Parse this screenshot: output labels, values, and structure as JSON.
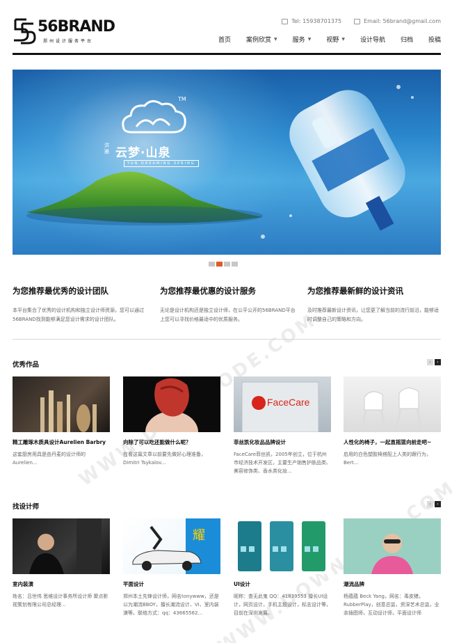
{
  "header": {
    "logo_text": "56BRAND",
    "logo_tagline": "郑州设计服务平台",
    "tel": "Tel: 15938701375",
    "email": "Email: 56brand@gmail.com",
    "nav": [
      {
        "label": "首页",
        "has_dropdown": false
      },
      {
        "label": "案例欣赏",
        "has_dropdown": true
      },
      {
        "label": "服务",
        "has_dropdown": true
      },
      {
        "label": "视野",
        "has_dropdown": true
      },
      {
        "label": "设计导航",
        "has_dropdown": false
      },
      {
        "label": "归档",
        "has_dropdown": false
      },
      {
        "label": "投稿",
        "has_dropdown": false
      }
    ]
  },
  "banner": {
    "brand_cn": "云梦·山泉",
    "brand_side": "洪雅",
    "brand_en": "YUN DREAMING SPRING",
    "tm": "TM",
    "slides": 4,
    "active_slide": 2
  },
  "intro": [
    {
      "title": "为您推荐最优秀的设计团队",
      "text": "本平台集合了优秀的设计机构和独立设计师资源，您可以通过56BRAND找到能够满足您设计需求的设计团队。"
    },
    {
      "title": "为您推荐最优惠的设计服务",
      "text": "无论是设计机构还是独立设计师，在公平公开的56BRAND平台上您可以寻找价格最适中的优质服务。"
    },
    {
      "title": "为您推荐最新鲜的设计资讯",
      "text": "及时推荐最新设计资讯，让您更了解当前的流行前沿，能够适时调整自己的策略和方向。"
    }
  ],
  "works": {
    "title": "优秀作品",
    "items": [
      {
        "title": "精工雕琢木质具设计Aurelien Barbry",
        "text": "这套厨房用具是由丹麦的设计师的Aurelien..."
      },
      {
        "title": "向除了可以吃还能做什么呢？",
        "text": "在看这篇文章以前要先做好心理准备，Dimitri Tsykalov..."
      },
      {
        "title": "菲丝凯化妆品品牌设计",
        "text": "FaceCare菲丝凯，2005年创立，位于杭州市经济技术开发区，主要生产销售护肤品类、美容修饰类、香水类化妆..."
      },
      {
        "title": "人性化的椅子，一起直摇篮向前走吧~",
        "text": "启用的白色塑胶椅搭配上人类的跟行为，Bert..."
      }
    ]
  },
  "designers": {
    "title": "找设计师",
    "items": [
      {
        "title": "室内装潢",
        "text": "姓名：吕世伟 思维设计事务所设计师 聚点影视策划有限公司总经理..."
      },
      {
        "title": "平面设计",
        "text": "郑州本土先锋设计师，网名tonywww，还是以为潮流BBOY，擅长潮流设计、VI、室内装潢等。联络方式：qq：43665562..."
      },
      {
        "title": "UI设计",
        "text": "昵称：查无此鬼 QQ：41839553 擅长UI设计，网页设计，手机主题设计，标志设计等，目前在深圳发展。"
      },
      {
        "title": "潮流品牌",
        "text": "杨蕴蕴 Beck Yang，网名：毒皮猪，RubberPlay，创意总监，资深艺术总监，业余插图师，互动设计师，平面设计师"
      }
    ]
  },
  "colors": {
    "accent": "#e05a2a",
    "rule": "#111111"
  }
}
